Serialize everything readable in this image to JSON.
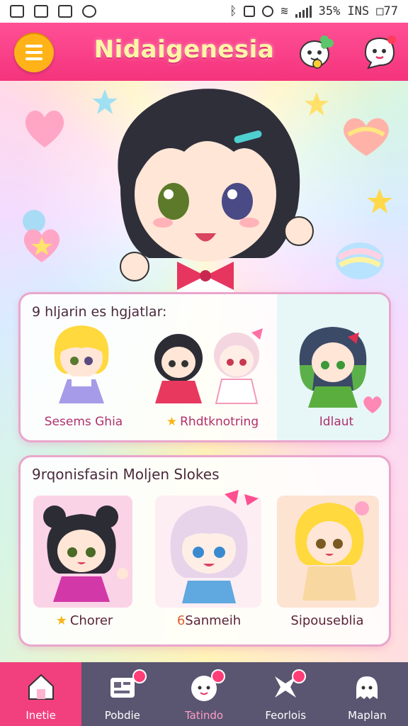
{
  "status_bar": {
    "battery": "35%",
    "right_text": "ΙΝS □77",
    "icons": [
      "gallery-icon",
      "image-icon",
      "bag-icon",
      "sync-icon",
      "bluetooth-icon",
      "vibrate-icon",
      "wifi-icon",
      "signal-icon"
    ]
  },
  "header": {
    "title": "Nidaigenesia",
    "menu_icon": "hamburger-icon",
    "icons": [
      "mascot-clover-icon",
      "mascot-chat-icon"
    ]
  },
  "section1": {
    "title": "9 hljarin es hgjatlar:",
    "characters": [
      {
        "name": "Sesems Ghia",
        "has_star": false
      },
      {
        "name": "Rhdtknotring",
        "has_star": true
      },
      {
        "name": "Idlaut",
        "has_star": false
      }
    ]
  },
  "section2": {
    "title": "9rqonisfasin Moljen Slokes",
    "characters": [
      {
        "name": "Chorer",
        "prefix": "★"
      },
      {
        "name": "Sanmeih",
        "prefix": "6"
      },
      {
        "name": "Sipouseblia",
        "prefix": ""
      }
    ]
  },
  "bottom_nav": {
    "items": [
      {
        "label": "Inetie",
        "icon": "home-icon",
        "active": true
      },
      {
        "label": "Pobdie",
        "icon": "gallery-board-icon",
        "active": false
      },
      {
        "label": "Tatindo",
        "icon": "mascot-icon",
        "active": false
      },
      {
        "label": "Feorlois",
        "icon": "star-burst-icon",
        "active": false
      },
      {
        "label": "Maplan",
        "icon": "ghost-mascot-icon",
        "active": false
      }
    ]
  },
  "colors": {
    "header": "#f4347d",
    "menu_button": "#ffb319",
    "title_text": "#fff5a6",
    "nav_bar": "#5a5570",
    "nav_active": "#f2407f",
    "card_border": "#e9a6cc"
  }
}
